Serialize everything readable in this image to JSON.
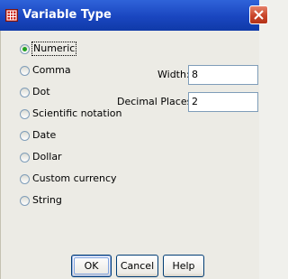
{
  "window": {
    "title": "Variable Type"
  },
  "types": [
    {
      "label": "Numeric",
      "checked": true
    },
    {
      "label": "Comma",
      "checked": false
    },
    {
      "label": "Dot",
      "checked": false
    },
    {
      "label": "Scientific notation",
      "checked": false
    },
    {
      "label": "Date",
      "checked": false
    },
    {
      "label": "Dollar",
      "checked": false
    },
    {
      "label": "Custom currency",
      "checked": false
    },
    {
      "label": "String",
      "checked": false
    }
  ],
  "fields": {
    "width_label": "Width:",
    "width_value": "8",
    "decimal_label": "Decimal Places:",
    "decimal_value": "2"
  },
  "buttons": {
    "ok": "OK",
    "cancel": "Cancel",
    "help": "Help"
  }
}
